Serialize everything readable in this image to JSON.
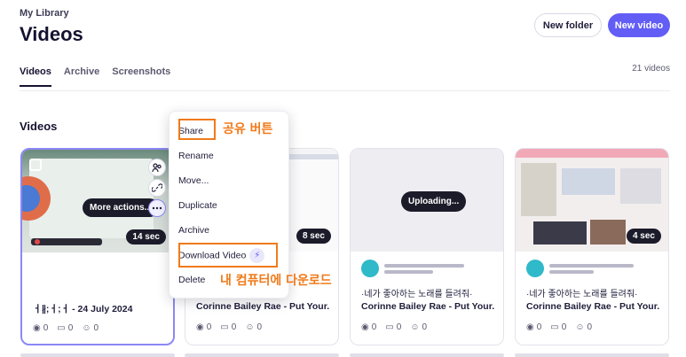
{
  "header": {
    "breadcrumb": "My Library",
    "title": "Videos",
    "new_folder_label": "New folder",
    "new_video_label": "New video"
  },
  "tabs": [
    {
      "label": "Videos",
      "active": true
    },
    {
      "label": "Archive",
      "active": false
    },
    {
      "label": "Screenshots",
      "active": false
    }
  ],
  "video_count": "21 videos",
  "section_title": "Videos",
  "cards": [
    {
      "title": "ㅓ∦;ㅓ;ㅓ - 24 July 2024",
      "duration": "14 sec",
      "hover_label": "More actions...",
      "stats": {
        "views": "0",
        "comments": "0",
        "reactions": "0"
      }
    },
    {
      "title": "Corinne Bailey Rae - Put Your...",
      "duration": "8 sec",
      "stats": {
        "views": "0",
        "comments": "0",
        "reactions": "0"
      }
    },
    {
      "title": "Corinne Bailey Rae - Put Your...",
      "subtitle": "·네가 좋아하는 노래를 들려줘·",
      "status": "Uploading...",
      "stats": {
        "views": "0",
        "comments": "0",
        "reactions": "0"
      }
    },
    {
      "title": "Corinne Bailey Rae - Put Your...",
      "subtitle": "·네가 좋아하는 노래를 들려줘·",
      "duration": "4 sec",
      "stats": {
        "views": "0",
        "comments": "0",
        "reactions": "0"
      }
    }
  ],
  "menu": {
    "items": [
      "Share",
      "Rename",
      "Move...",
      "Duplicate",
      "Archive",
      "Download Video",
      "Delete"
    ]
  },
  "annotations": {
    "share": "공유 버튼",
    "download": "내 컴퓨터에 다운로드"
  },
  "colors": {
    "accent": "#625df5",
    "annotation": "#f07a1a"
  }
}
